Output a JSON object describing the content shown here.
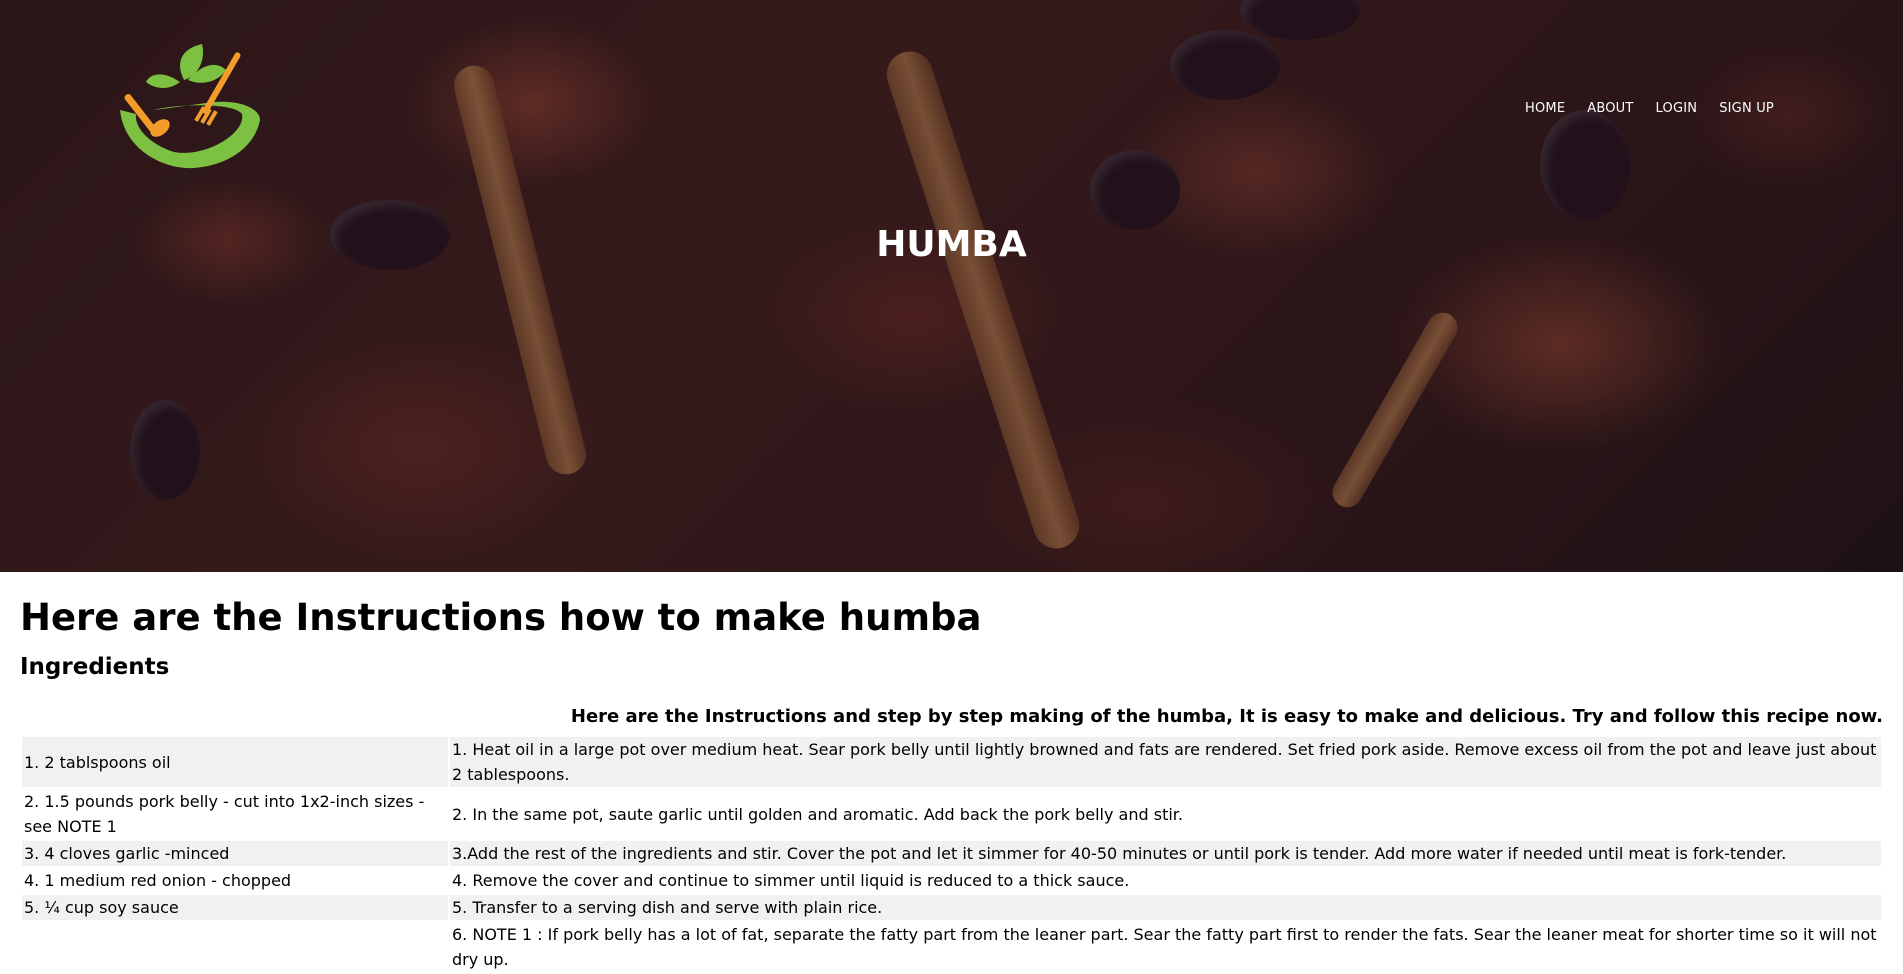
{
  "header": {
    "logo_name": "bowl-logo",
    "nav": [
      {
        "label": "HOME"
      },
      {
        "label": "ABOUT"
      },
      {
        "label": "LOGIN"
      },
      {
        "label": "SIGN UP"
      }
    ],
    "hero_title": "HUMBA"
  },
  "main": {
    "heading": "Here are the Instructions how to make humba",
    "ingredients_heading": "Ingredients",
    "intro": "Here are the Instructions and step by step making of the humba, It is easy to make and delicious. Try and follow this recipe now.",
    "rows": [
      {
        "ingredient": "1. 2 tablspoons oil",
        "instruction": "1. Heat oil in a large pot over medium heat. Sear pork belly until lightly browned and fats are rendered. Set fried pork aside. Remove excess oil from the pot and leave just about 2 tablespoons."
      },
      {
        "ingredient": "2. 1.5 pounds pork belly - cut into 1x2-inch sizes -see NOTE 1",
        "instruction": "2. In the same pot, saute garlic until golden and aromatic. Add back the pork belly and stir."
      },
      {
        "ingredient": "3. 4 cloves garlic -minced",
        "instruction": "3.Add the rest of the ingredients and stir. Cover the pot and let it simmer for 40-50 minutes or until pork is tender. Add more water if needed until meat is fork-tender."
      },
      {
        "ingredient": "4. 1 medium red onion - chopped",
        "instruction": "4. Remove the cover and continue to simmer until liquid is reduced to a thick sauce."
      },
      {
        "ingredient": "5. ¼ cup soy sauce",
        "instruction": "5. Transfer to a serving dish and serve with plain rice."
      },
      {
        "ingredient": "",
        "instruction": "6. NOTE 1 : If pork belly has a lot of fat, separate the fatty part from the leaner part. Sear the fatty part first to render the fats. Sear the leaner meat for shorter time so it will not dry up."
      }
    ]
  },
  "colors": {
    "logo_green": "#7cc142",
    "logo_orange": "#f39c2a",
    "row_stripe": "#f1f1f1"
  }
}
